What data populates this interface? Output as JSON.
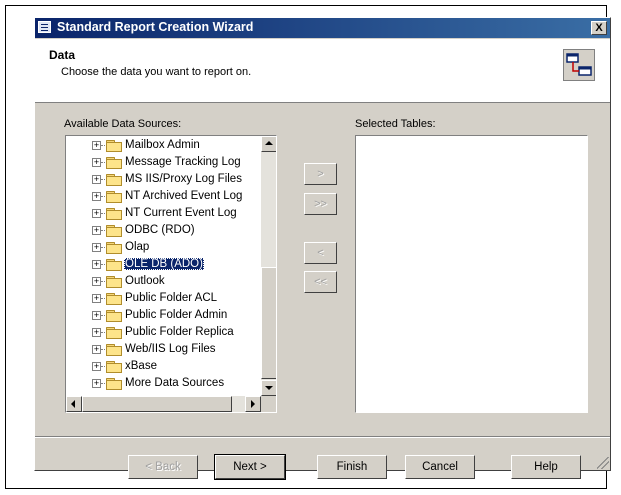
{
  "window": {
    "title": "Standard Report Creation Wizard",
    "close_label": "X"
  },
  "header": {
    "title": "Data",
    "subtitle": "Choose the data you want to report on."
  },
  "available": {
    "label": "Available Data Sources:",
    "items": [
      {
        "label": "Mailbox Admin"
      },
      {
        "label": "Message Tracking Log"
      },
      {
        "label": "MS IIS/Proxy Log Files"
      },
      {
        "label": "NT Archived Event Log"
      },
      {
        "label": "NT Current Event Log"
      },
      {
        "label": "ODBC (RDO)"
      },
      {
        "label": "Olap"
      },
      {
        "label": "OLE DB (ADO)",
        "selected": true
      },
      {
        "label": "Outlook"
      },
      {
        "label": "Public Folder ACL"
      },
      {
        "label": "Public Folder Admin"
      },
      {
        "label": "Public Folder Replica"
      },
      {
        "label": "Web/IIS Log Files"
      },
      {
        "label": "xBase"
      },
      {
        "label": "More Data Sources"
      }
    ]
  },
  "selected_tables": {
    "label": "Selected Tables:"
  },
  "move_buttons": {
    "add": ">",
    "add_all": ">>",
    "remove": "<",
    "remove_all": "<<"
  },
  "footer": {
    "back": "< Back",
    "next": "Next >",
    "finish": "Finish",
    "cancel": "Cancel",
    "help": "Help"
  }
}
